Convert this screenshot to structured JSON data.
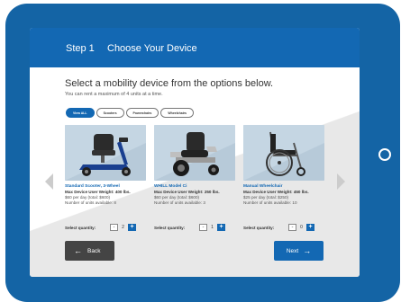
{
  "header": {
    "step": "Step 1",
    "title": "Choose Your Device"
  },
  "main": {
    "heading": "Select a mobility device from the options below.",
    "subheading": "You can rent a maximum of 4 units at a time."
  },
  "filters": [
    {
      "label": "View ALL",
      "active": true
    },
    {
      "label": "Scooters",
      "active": false
    },
    {
      "label": "Powerchairs",
      "active": false
    },
    {
      "label": "Wheelchairs",
      "active": false
    }
  ],
  "devices": [
    {
      "name": "Standard Scooter, 3-Wheel",
      "max_weight": "Max Device User Weight:  400 lbs.",
      "price": "$60 per day (total: $600)",
      "available": "Number of units available:  8",
      "qty_label": "Select quantity:",
      "quantity": "2",
      "image_icon": "scooter-icon"
    },
    {
      "name": "WHILL Model Ci",
      "max_weight": "Max Device User Weight:  250 lbs.",
      "price": "$60 per day (total: $600)",
      "available": "Number of units available:  3",
      "qty_label": "Select quantity:",
      "quantity": "1",
      "image_icon": "powerchair-icon"
    },
    {
      "name": "Manual Wheelchair",
      "max_weight": "Max Device User Weight:  450 lbs.",
      "price": "$25 per day (total: $250)",
      "available": "Number of units available:  10",
      "qty_label": "Select quantity:",
      "quantity": "0",
      "image_icon": "wheelchair-icon"
    }
  ],
  "controls": {
    "minus": "-",
    "plus": "+"
  },
  "nav": {
    "back_label": "Back",
    "back_arrow": "←",
    "next_label": "Next",
    "next_arrow": "→"
  },
  "colors": {
    "accent": "#1368b3",
    "frame": "#1464a5",
    "back_button": "#444444"
  }
}
